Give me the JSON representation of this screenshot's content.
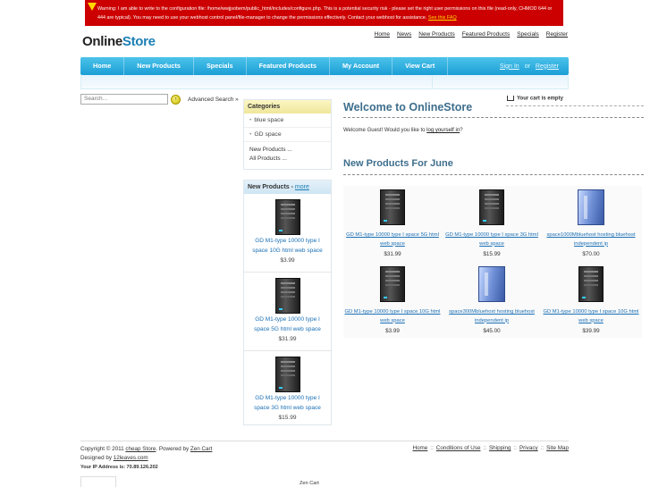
{
  "warning": {
    "text": "Warning: I am able to write to the configuration file: /home/wwjjsobem/public_html/includes/configure.php. This is a potential security risk - please set the right user permissions on this file (read-only, CHMOD 644 or 444 are typical). You may need to use your webhost control panel/file-manager to change the permissions effectively. Contact your webhost for assistance.",
    "link": "See this FAQ"
  },
  "logo": {
    "part1": "Online",
    "part2": "Store"
  },
  "top_nav": [
    "Home",
    "News",
    "New Products",
    "Featured Products",
    "Specials",
    "Register"
  ],
  "main_nav": {
    "items": [
      "Home",
      "New Products",
      "Specials",
      "Featured Products",
      "My Account",
      "View Cart"
    ],
    "sign_in": "Sign In",
    "or": "or",
    "register": "Register"
  },
  "search": {
    "placeholder": "Search...",
    "advanced": "Advanced Search »"
  },
  "categories": {
    "title": "Categories",
    "items": [
      "blue space",
      "GD space"
    ],
    "new_products": "New Products ...",
    "all_products": "All Products ..."
  },
  "sidebar_new": {
    "title": "New Products - ",
    "more": "more",
    "items": [
      {
        "name": "GD M1-type 10000 type I space 10G html web space",
        "price": "$3.99"
      },
      {
        "name": "GD M1-type 10000 type I space 5G html web space",
        "price": "$31.99"
      },
      {
        "name": "GD M1-type 10000 type I space 3G html web space",
        "price": "$15.99"
      }
    ]
  },
  "cart": {
    "status": "Your cart is empty"
  },
  "welcome": {
    "title": "Welcome to OnlineStore",
    "greeting_prefix": "Welcome Guest! Would you like to ",
    "greeting_link": "log yourself in",
    "greeting_suffix": "?"
  },
  "new_june": {
    "title": "New Products For June",
    "items": [
      {
        "name": "GD M1-type 10000 type I space 5G html web space",
        "price": "$31.99",
        "img": "black-server-icon"
      },
      {
        "name": "GD M1-type 10000 type I space 3G html web space",
        "price": "$15.99",
        "img": "black-server-icon"
      },
      {
        "name": "space1000Mbluehost hosting bluehost independent ip",
        "price": "$70.00",
        "img": "blue-server-icon"
      },
      {
        "name": "GD M1-type 10000 type I space 10G html web space",
        "price": "$3.99",
        "img": "black-server-icon"
      },
      {
        "name": "space300Mbluehost hosting bluehost independent ip",
        "price": "$45.00",
        "img": "blue-server-icon"
      },
      {
        "name": "GD M1-type 10000 type I space 10G html web space",
        "price": "$39.99",
        "img": "black-server-icon"
      }
    ]
  },
  "footer": {
    "copyright_prefix": "Copyright © 2011 ",
    "store_link": "cheap Store",
    "powered_by": ". Powered by ",
    "zen_link": "Zen Cart",
    "designed_by": "Designed by ",
    "designer_link": "12leaves.com",
    "ip": "Your IP Address is: 70.89.126.202",
    "links": [
      "Home",
      "Conditions of Use",
      "Shipping",
      "Privacy",
      "Site Map"
    ],
    "separator": "::",
    "zen_footer": "Zen Cart"
  },
  "colors": {
    "nav_blue": "#1a9ed6",
    "warning_red": "#cc0000",
    "heading_blue": "#3d6e8c",
    "category_header": "#efe79a"
  }
}
